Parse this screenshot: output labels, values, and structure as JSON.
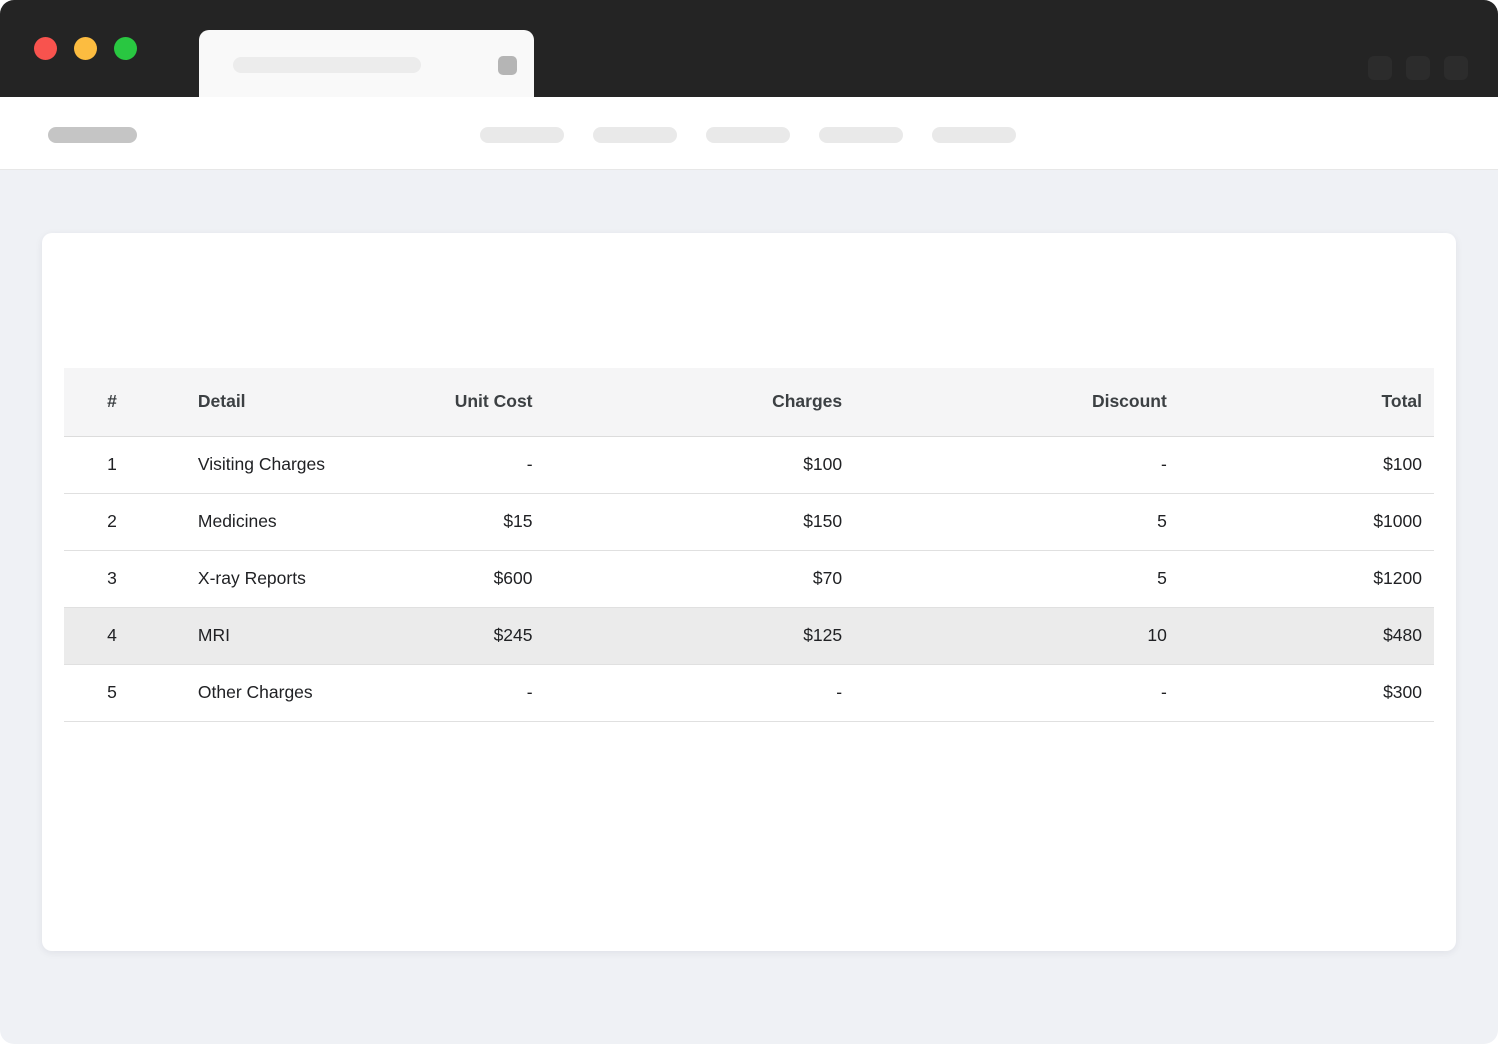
{
  "window": {
    "controls": [
      {
        "key": "close",
        "color": "#f8534e"
      },
      {
        "key": "minimize",
        "color": "#fcbc40"
      },
      {
        "key": "maximize",
        "color": "#29c741"
      }
    ]
  },
  "table": {
    "columns": [
      {
        "key": "num",
        "label": "#"
      },
      {
        "key": "detail",
        "label": "Detail"
      },
      {
        "key": "unit_cost",
        "label": "Unit Cost"
      },
      {
        "key": "charges",
        "label": "Charges"
      },
      {
        "key": "discount",
        "label": "Discount"
      },
      {
        "key": "total",
        "label": "Total"
      }
    ],
    "rows": [
      {
        "values": [
          "1",
          "Visiting Charges",
          "-",
          "$100",
          "-",
          "$100"
        ],
        "highlighted": false
      },
      {
        "values": [
          "2",
          "Medicines",
          "$15",
          "$150",
          "5",
          "$1000"
        ],
        "highlighted": false
      },
      {
        "values": [
          "3",
          "X-ray Reports",
          "$600",
          "$70",
          "5",
          "$1200"
        ],
        "highlighted": false
      },
      {
        "values": [
          "4",
          "MRI",
          "$245",
          "$125",
          "10",
          "$480"
        ],
        "highlighted": true
      },
      {
        "values": [
          "5",
          "Other Charges",
          "-",
          "-",
          "-",
          "$300"
        ],
        "highlighted": false
      }
    ]
  },
  "colors": {
    "titlebar": "#242424",
    "page_background": "#eff1f5",
    "card_background": "#ffffff",
    "header_row_background": "#f5f5f6",
    "highlight_row_background": "#ebebeb",
    "row_border": "#e0e0e0",
    "header_text": "#3c4043",
    "body_text": "#202124"
  }
}
